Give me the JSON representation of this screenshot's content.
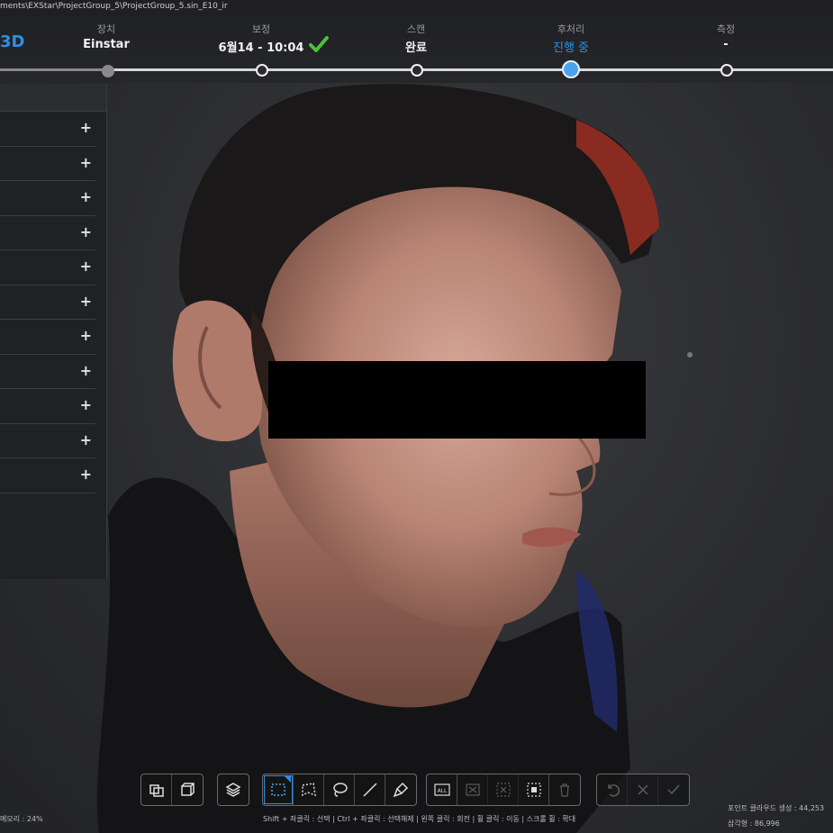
{
  "app": {
    "file_path": "ments\\EXStar\\ProjectGroup_5\\ProjectGroup_5.sin_E10_ir",
    "logo_text": "3D"
  },
  "steps": [
    {
      "label": "장치",
      "value": "Einstar"
    },
    {
      "label": "보정",
      "value": "6월14 - 10:04"
    },
    {
      "label": "스캔",
      "value": "완료"
    },
    {
      "label": "후처리",
      "value": "진행 중"
    },
    {
      "label": "측정",
      "value": "-"
    }
  ],
  "panel": {
    "rows": [
      "+",
      "+",
      "+",
      "+",
      "+",
      "+",
      "+",
      "+",
      "+",
      "+",
      "+"
    ]
  },
  "toolbar": {
    "groups": [
      [
        "view-object-icon",
        "view-box-icon"
      ],
      [
        "layers-icon"
      ],
      [
        "rect-select-icon",
        "polygon-select-icon",
        "lasso-select-icon",
        "line-select-icon",
        "brush-select-icon"
      ],
      [
        "select-all-icon",
        "deselect-icon",
        "invert-select-icon",
        "select-connected-icon",
        "delete-icon"
      ],
      [
        "undo-icon",
        "cancel-icon",
        "confirm-icon"
      ]
    ]
  },
  "hint": "Shift + 좌클릭 : 선택 | Ctrl + 좌클릭 : 선택해제 | 왼쪽 클릭 : 회전 | 휠 클릭 : 이동 | 스크롤 휠 : 확대",
  "memory": "메모리 : 24%",
  "stats": {
    "points": "포인트 클라우드 생성 : 44,253",
    "triangles": "삼각형 : 86,996"
  },
  "colors": {
    "accent": "#2f8fe8",
    "check": "#4cc23a"
  }
}
